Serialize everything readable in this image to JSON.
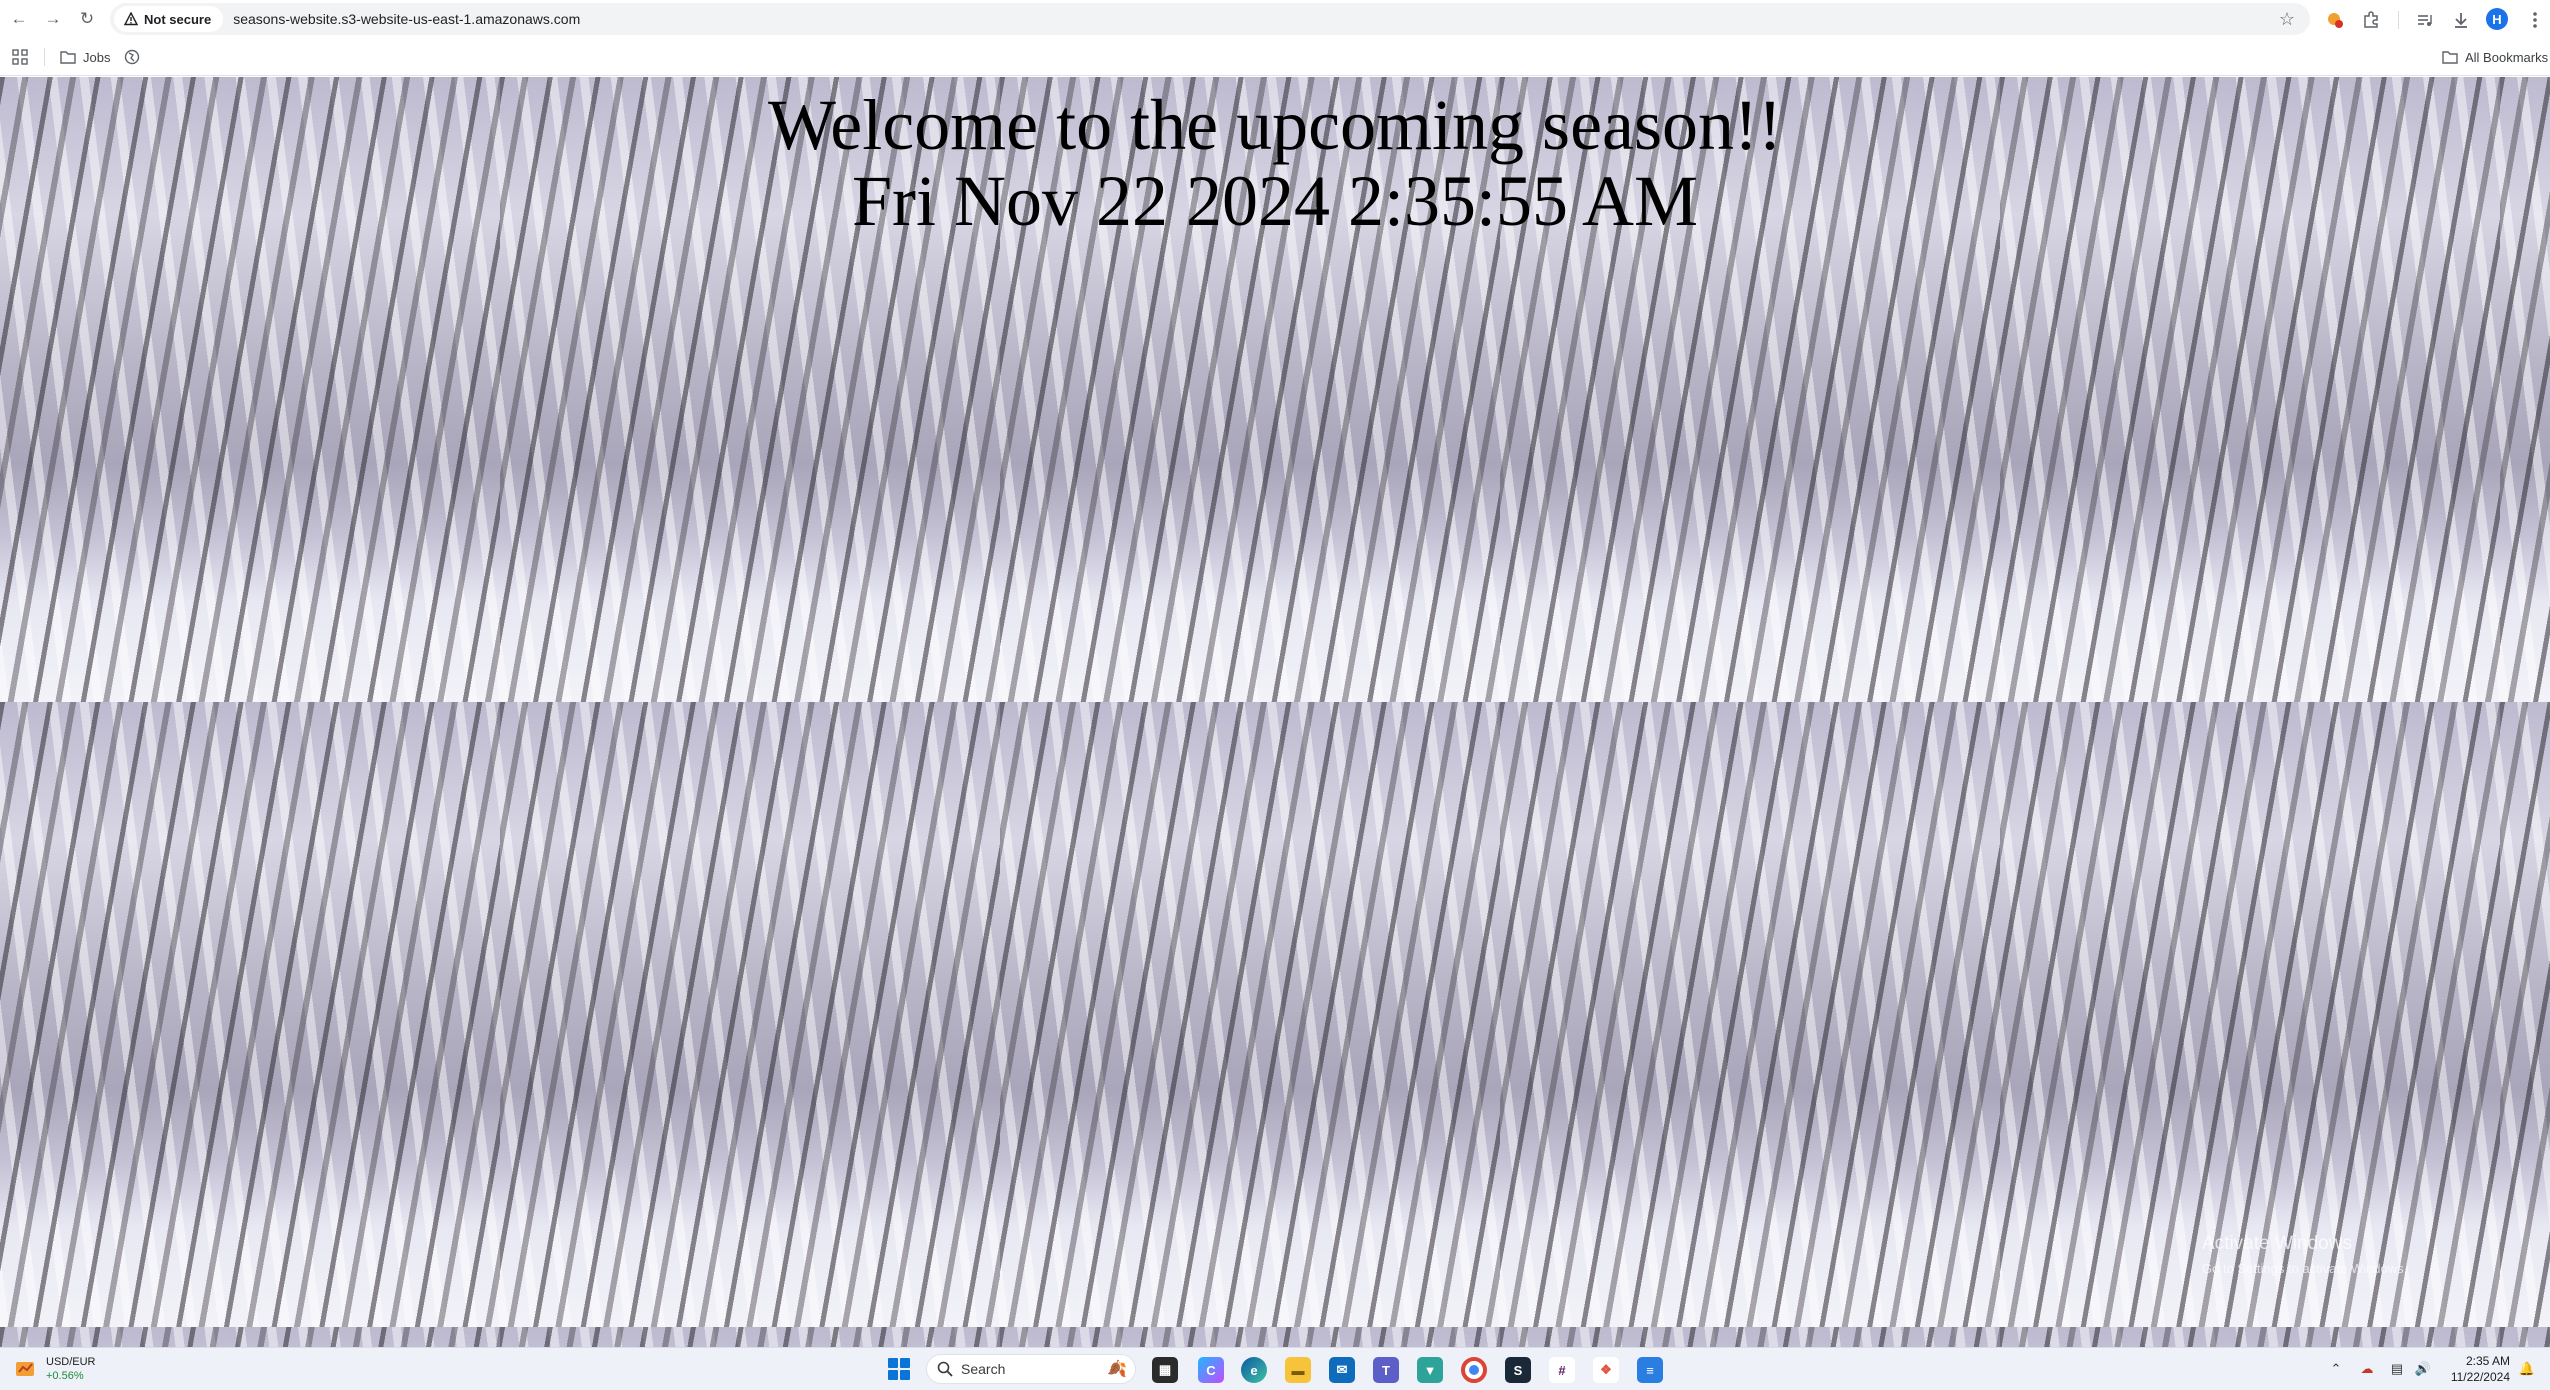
{
  "browser": {
    "security_label": "Not secure",
    "url": "seasons-website.s3-website-us-east-1.amazonaws.com",
    "icons": {
      "back": "back-arrow-icon",
      "forward": "forward-arrow-icon",
      "reload": "reload-icon",
      "bookmark_star": "star-icon",
      "extension": "extension-icon",
      "puzzle": "puzzle-icon",
      "media": "media-controls-icon",
      "download": "download-icon",
      "menu": "more-vertical-icon"
    },
    "profile_initial": "H",
    "accent_color": "#1a73e8"
  },
  "bookmarks": {
    "items": [
      {
        "label": "Jobs",
        "icon": "folder-icon"
      }
    ],
    "all_bookmarks_label": "All Bookmarks"
  },
  "page": {
    "heading": "Welcome to the upcoming season!!",
    "datetime": "Fri Nov 22 2024 2:35:55 AM",
    "background_theme": "snowy-forest-tiled"
  },
  "watermark": {
    "title": "Activate Windows",
    "subtitle": "Go to Settings to activate Windows."
  },
  "taskbar": {
    "widget": {
      "name": "USD/EUR",
      "change": "+0.56%"
    },
    "search_label": "Search",
    "time": "2:35 AM",
    "date": "11/22/2024"
  }
}
